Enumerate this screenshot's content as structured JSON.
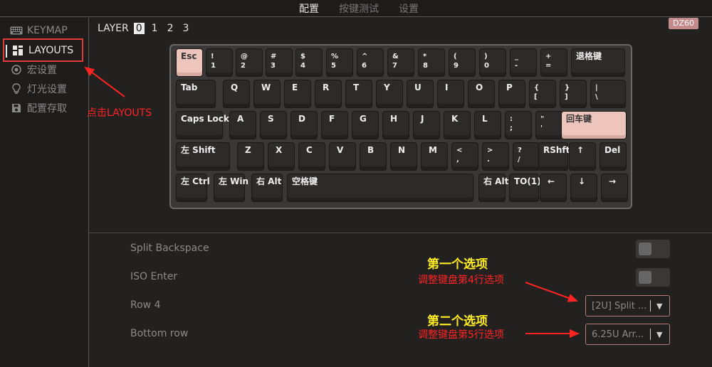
{
  "top_tabs": [
    {
      "label": "配置"
    },
    {
      "label": "按键测试"
    },
    {
      "label": "设置"
    }
  ],
  "sidebar": {
    "items": [
      {
        "label": "KEYMAP",
        "icon": "keyboard-icon"
      },
      {
        "label": "LAYOUTS",
        "icon": "layout-grid-icon"
      },
      {
        "label": "宏设置",
        "icon": "macro-circle-icon"
      },
      {
        "label": "灯光设置",
        "icon": "bulb-icon"
      },
      {
        "label": "配置存取",
        "icon": "save-icon"
      }
    ]
  },
  "layer": {
    "label": "LAYER",
    "numbers": [
      "0",
      "1",
      "2",
      "3"
    ],
    "selected": "0"
  },
  "badge": "DZ60",
  "keyboard": {
    "keys": [
      "Esc",
      "!\n1",
      "@\n2",
      "#\n3",
      "$\n4",
      "%\n5",
      "^\n6",
      "&\n7",
      "*\n8",
      "(\n9",
      ")\n0",
      "_\n-",
      "+\n=",
      "退格键",
      "Tab",
      "Q",
      "W",
      "E",
      "R",
      "T",
      "Y",
      "U",
      "I",
      "O",
      "P",
      "{\n[",
      "}\n]",
      "|\n\\",
      "Caps Lock",
      "A",
      "S",
      "D",
      "F",
      "G",
      "H",
      "J",
      "K",
      "L",
      ":\n;",
      "\"\n'",
      "回车键",
      "左 Shift",
      "Z",
      "X",
      "C",
      "V",
      "B",
      "N",
      "M",
      "<\n,",
      ">\n.",
      "?\n/",
      "RShft",
      "↑",
      "Del",
      "左 Ctrl",
      "左 Win",
      "右 Alt",
      "空格键",
      "右 Alt",
      "TO(1)",
      "←",
      "↓",
      "→"
    ]
  },
  "options": {
    "split_backspace": {
      "label": "Split Backspace",
      "enabled": false
    },
    "iso_enter": {
      "label": "ISO Enter",
      "enabled": false
    },
    "row4": {
      "label": "Row 4",
      "value": "[2U] Split ..."
    },
    "bottom_row": {
      "label": "Bottom row",
      "value": "6.25U Arr..."
    }
  },
  "annotations": {
    "click_layouts": "点击LAYOUTS",
    "option1_title": "第一个选项",
    "option1_desc": "调整键盘第4行选项",
    "option2_title": "第二个选项",
    "option2_desc": "调整键盘第5行选项"
  },
  "colors": {
    "accent_pink": "#edc5bd",
    "badge": "#c58a8a",
    "annotation_red": "#ff2424",
    "annotation_yellow": "#ffee22"
  }
}
